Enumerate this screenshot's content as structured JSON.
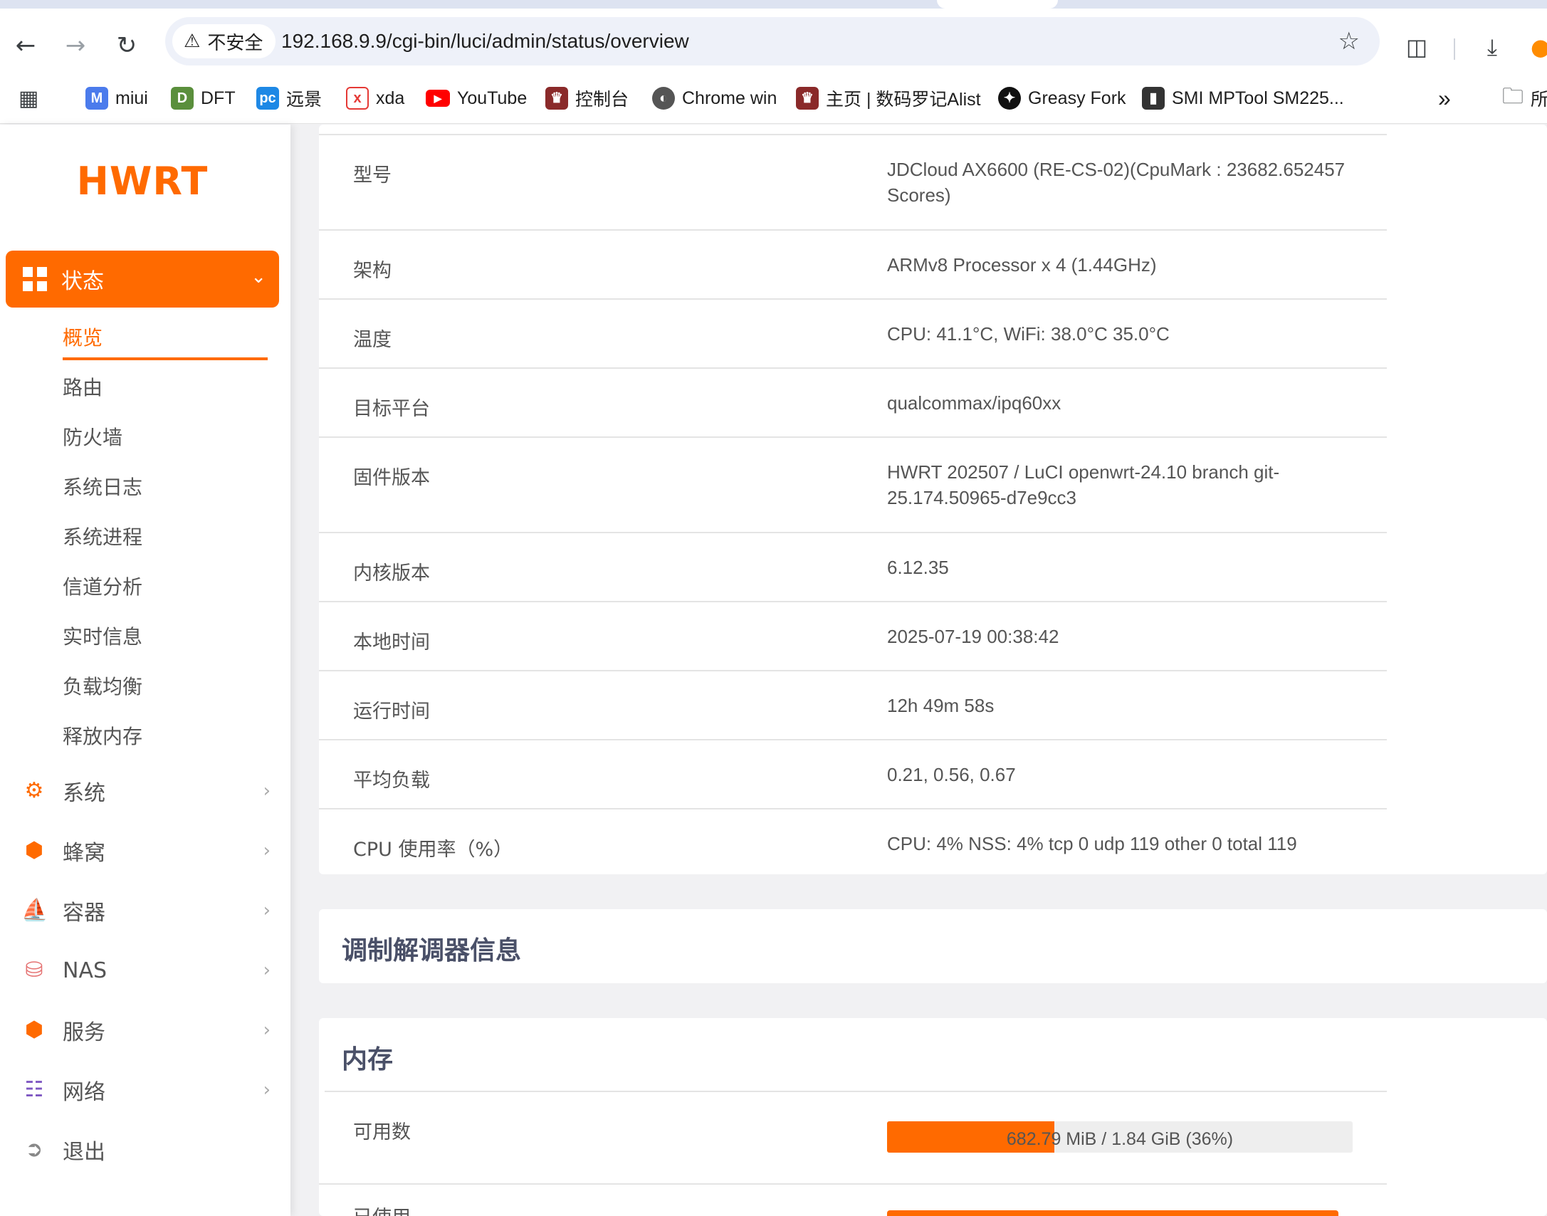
{
  "browser": {
    "security_label": "不安全",
    "url": "192.168.9.9/cgi-bin/luci/admin/status/overview",
    "icons": [
      "back-icon",
      "forward-icon",
      "reload-icon",
      "warning-icon",
      "star-icon",
      "extensions-icon",
      "download-icon",
      "profile-icon"
    ],
    "bookmarks": [
      {
        "label": "miui",
        "color": "#4b7bec"
      },
      {
        "label": "DFT",
        "color": "#5a8f3c"
      },
      {
        "label": "远景",
        "color": "#1e88e5"
      },
      {
        "label": "xda",
        "color": "#e53935"
      },
      {
        "label": "YouTube",
        "color": "#ff0000"
      },
      {
        "label": "控制台",
        "color": "#8a2a2a"
      },
      {
        "label": "Chrome win",
        "color": "#555555"
      },
      {
        "label": "主页 | 数码罗记Alist",
        "color": "#8a2a2a"
      },
      {
        "label": "Greasy Fork",
        "color": "#111111"
      },
      {
        "label": "SMI MPTool SM225...",
        "color": "#333333"
      }
    ],
    "bookmarks_overflow": "»",
    "folder_label_partial": "所"
  },
  "sidebar": {
    "logo": "HWRT",
    "active_menu": "状态",
    "submenu": [
      "概览",
      "路由",
      "防火墙",
      "系统日志",
      "系统进程",
      "信道分析",
      "实时信息",
      "负载均衡",
      "释放内存"
    ],
    "menu": [
      {
        "label": "系统",
        "icon": "gear-icon",
        "color": "#ff6a00"
      },
      {
        "label": "蜂窝",
        "icon": "cube-icon",
        "color": "#ff6a00"
      },
      {
        "label": "容器",
        "icon": "docker-icon",
        "color": "#3a7bd5"
      },
      {
        "label": "NAS",
        "icon": "database-icon",
        "color": "#e57373"
      },
      {
        "label": "服务",
        "icon": "cube-icon",
        "color": "#ff6a00"
      },
      {
        "label": "网络",
        "icon": "network-icon",
        "color": "#7e57c2"
      },
      {
        "label": "退出",
        "icon": "logout-icon",
        "color": "#888888"
      }
    ],
    "accent": "#ff6a00"
  },
  "system": {
    "rows": [
      {
        "key": "型号",
        "value": "JDCloud AX6600 (RE-CS-02)(CpuMark : 23682.652457 Scores)"
      },
      {
        "key": "架构",
        "value": "ARMv8 Processor x 4 (1.44GHz)"
      },
      {
        "key": "温度",
        "value": "CPU: 41.1°C, WiFi: 38.0°C 35.0°C"
      },
      {
        "key": "目标平台",
        "value": "qualcommax/ipq60xx"
      },
      {
        "key": "固件版本",
        "value": "HWRT 202507 / LuCI openwrt-24.10 branch git-25.174.50965-d7e9cc3"
      },
      {
        "key": "内核版本",
        "value": "6.12.35"
      },
      {
        "key": "本地时间",
        "value": "2025-07-19 00:38:42"
      },
      {
        "key": "运行时间",
        "value": "12h 49m 58s"
      },
      {
        "key": "平均负载",
        "value": "0.21, 0.56, 0.67"
      },
      {
        "key": "CPU 使用率（%）",
        "value": "CPU: 4% NSS: 4% tcp 0 udp 119 other 0 total 119"
      }
    ]
  },
  "modem": {
    "title": "调制解调器信息"
  },
  "memory": {
    "title": "内存",
    "available_label": "可用数",
    "available_text": "682.79 MiB / 1.84 GiB (36%)",
    "available_fraction": 0.36,
    "used_label_partial": "已使用"
  }
}
